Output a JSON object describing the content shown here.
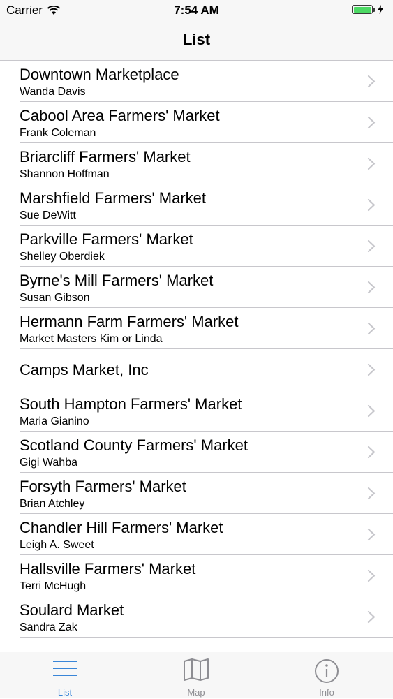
{
  "status_bar": {
    "carrier": "Carrier",
    "time": "7:54 AM",
    "battery_color": "#4cd964"
  },
  "nav": {
    "title": "List"
  },
  "markets": [
    {
      "name": "Downtown Marketplace",
      "contact": "Wanda Davis"
    },
    {
      "name": "Cabool Area Farmers' Market",
      "contact": "Frank Coleman"
    },
    {
      "name": "Briarcliff Farmers' Market",
      "contact": "Shannon Hoffman"
    },
    {
      "name": "Marshfield Farmers' Market",
      "contact": "Sue DeWitt"
    },
    {
      "name": "Parkville Farmers' Market",
      "contact": "Shelley Oberdiek"
    },
    {
      "name": "Byrne's Mill Farmers' Market",
      "contact": "Susan Gibson"
    },
    {
      "name": "Hermann Farm Farmers' Market",
      "contact": "Market Masters Kim or Linda"
    },
    {
      "name": "Camps Market, Inc",
      "contact": ""
    },
    {
      "name": "South Hampton Farmers' Market",
      "contact": "Maria Gianino"
    },
    {
      "name": "Scotland County Farmers' Market",
      "contact": "Gigi Wahba"
    },
    {
      "name": "Forsyth Farmers' Market",
      "contact": "Brian Atchley"
    },
    {
      "name": "Chandler Hill Farmers' Market",
      "contact": "Leigh A. Sweet"
    },
    {
      "name": "Hallsville Farmers' Market",
      "contact": "Terri McHugh"
    },
    {
      "name": "Soulard Market",
      "contact": "Sandra Zak"
    }
  ],
  "tabs": [
    {
      "label": "List",
      "icon": "list-icon",
      "active": true
    },
    {
      "label": "Map",
      "icon": "map-icon",
      "active": false
    },
    {
      "label": "Info",
      "icon": "info-icon",
      "active": false
    }
  ],
  "colors": {
    "accent": "#3a86d8",
    "inactive": "#8e8e93"
  }
}
